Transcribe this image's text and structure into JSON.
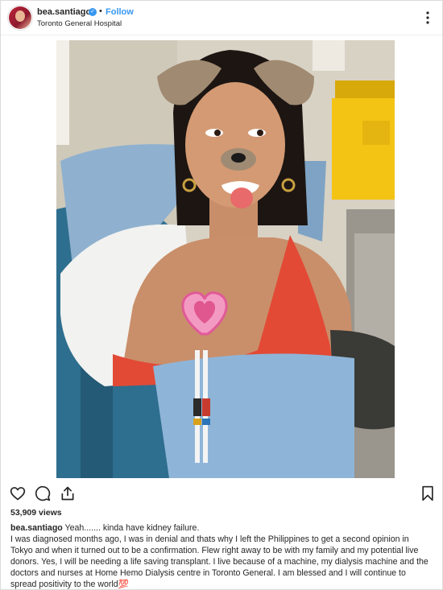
{
  "post": {
    "username": "bea.santiago",
    "separator": "•",
    "follow_label": "Follow",
    "location": "Toronto General Hospital",
    "views": "53,909 views",
    "caption_username": "bea.santiago",
    "caption_first": "Yeah....... kinda have kidney failure.",
    "caption_body": "I was diagnosed months ago, I was in denial and thats why I left the Philippines to get a second opinion in Tokyo and when it turned out to be a confirmation. Flew right away to be with my family and my potential live donors. Yes, I will be needing a life saving transplant. I live because of a machine, my dialysis machine and the doctors and nurses at Home Hemo Dialysis centre in Toronto General. I am blessed and I will continue to spread positivity to the world💯"
  },
  "icons": {
    "verified": "verified-badge-icon",
    "more": "more-options-icon",
    "like": "heart-icon",
    "comment": "comment-icon",
    "share": "share-icon",
    "save": "bookmark-icon"
  },
  "colors": {
    "link_blue": "#3897f0",
    "text": "#262626",
    "border": "#dbdbdb"
  }
}
